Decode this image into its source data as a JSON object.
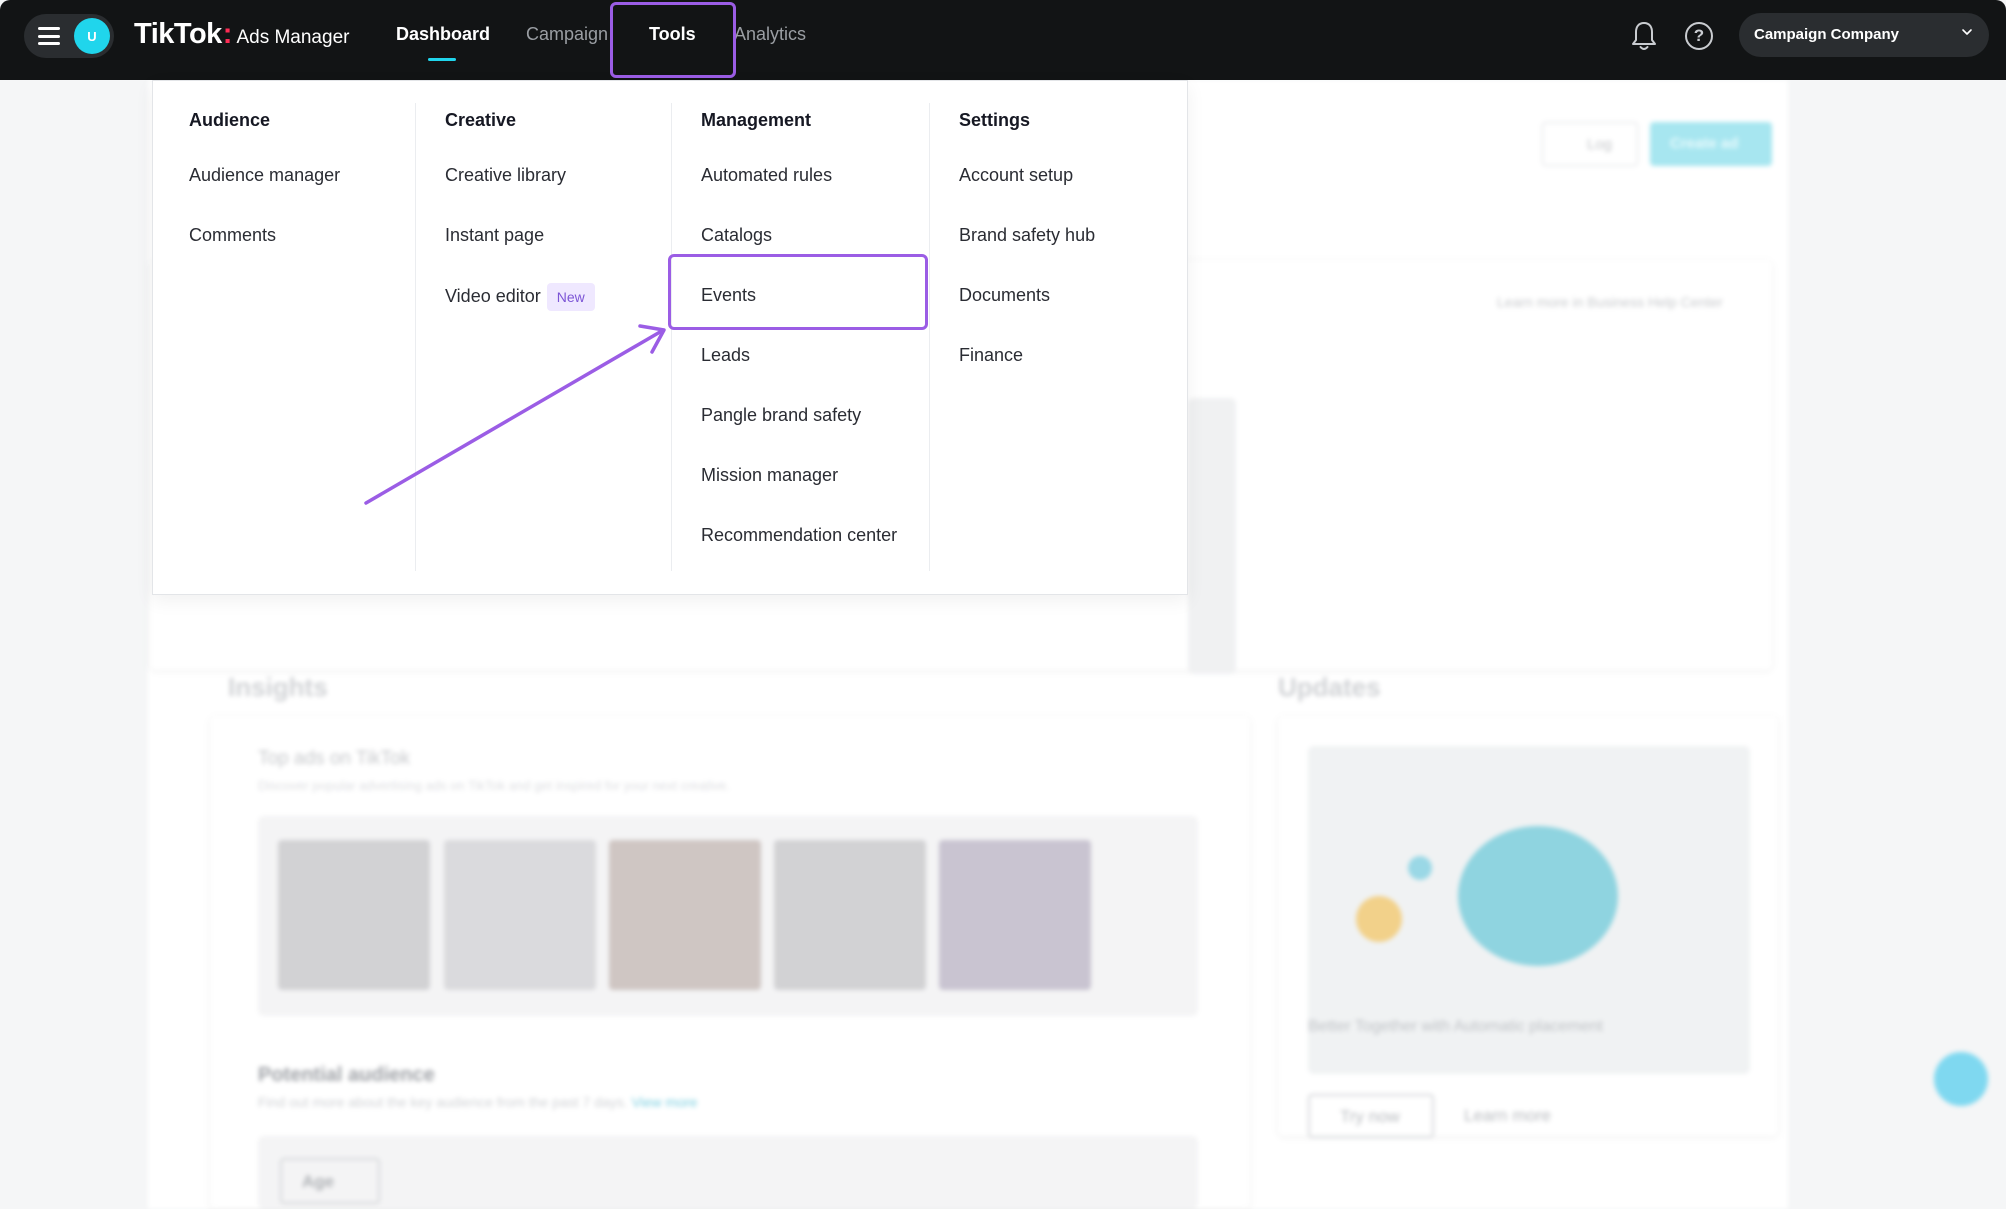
{
  "header": {
    "avatar_initial": "U",
    "logo_main": "TikTok",
    "logo_colon": ":",
    "logo_sub": "Ads Manager",
    "tabs": [
      {
        "label": "Dashboard"
      },
      {
        "label": "Campaign"
      },
      {
        "label": "Tools"
      },
      {
        "label": "Analytics"
      }
    ],
    "help_glyph": "?",
    "company_label": "Campaign Company"
  },
  "background": {
    "log_button": "Log",
    "create_ad_button": "Create ad",
    "help_center_note": "Learn more in Business Help Center",
    "insights_title": "Insights",
    "updates_title": "Updates",
    "top_ads_title": "Top ads on TikTok",
    "top_ads_sub": "Discover popular advertising ads on TikTok and get inspired for your next creative.",
    "potential_audience_title": "Potential audience",
    "potential_audience_sub": "Find out more about the key audience from the past 7 days.",
    "view_more": "View more",
    "updates_card_title": "Better Together with Automatic placement",
    "try_now": "Try now",
    "learn_more": "Learn more",
    "age_filter": "Age"
  },
  "tools_menu": {
    "columns": [
      {
        "heading": "Audience",
        "items": [
          "Audience manager",
          "Comments"
        ]
      },
      {
        "heading": "Creative",
        "items": [
          "Creative library",
          "Instant page",
          "Video editor"
        ],
        "badge": "New"
      },
      {
        "heading": "Management",
        "items": [
          "Automated rules",
          "Catalogs",
          "Events",
          "Leads",
          "Pangle brand safety",
          "Mission manager",
          "Recommendation center"
        ]
      },
      {
        "heading": "Settings",
        "items": [
          "Account setup",
          "Brand safety hub",
          "Documents",
          "Finance"
        ]
      }
    ]
  },
  "colors": {
    "nav_bg": "#121415",
    "accent_cyan": "#20d5ec",
    "highlight_purple": "#9b5de5",
    "new_badge_bg": "#efe8ff",
    "new_badge_text": "#7c55d6"
  },
  "icons": {
    "menu": "hamburger-icon",
    "notifications": "bell-icon",
    "help": "question-circle-icon",
    "dropdown": "chevron-down-icon"
  }
}
